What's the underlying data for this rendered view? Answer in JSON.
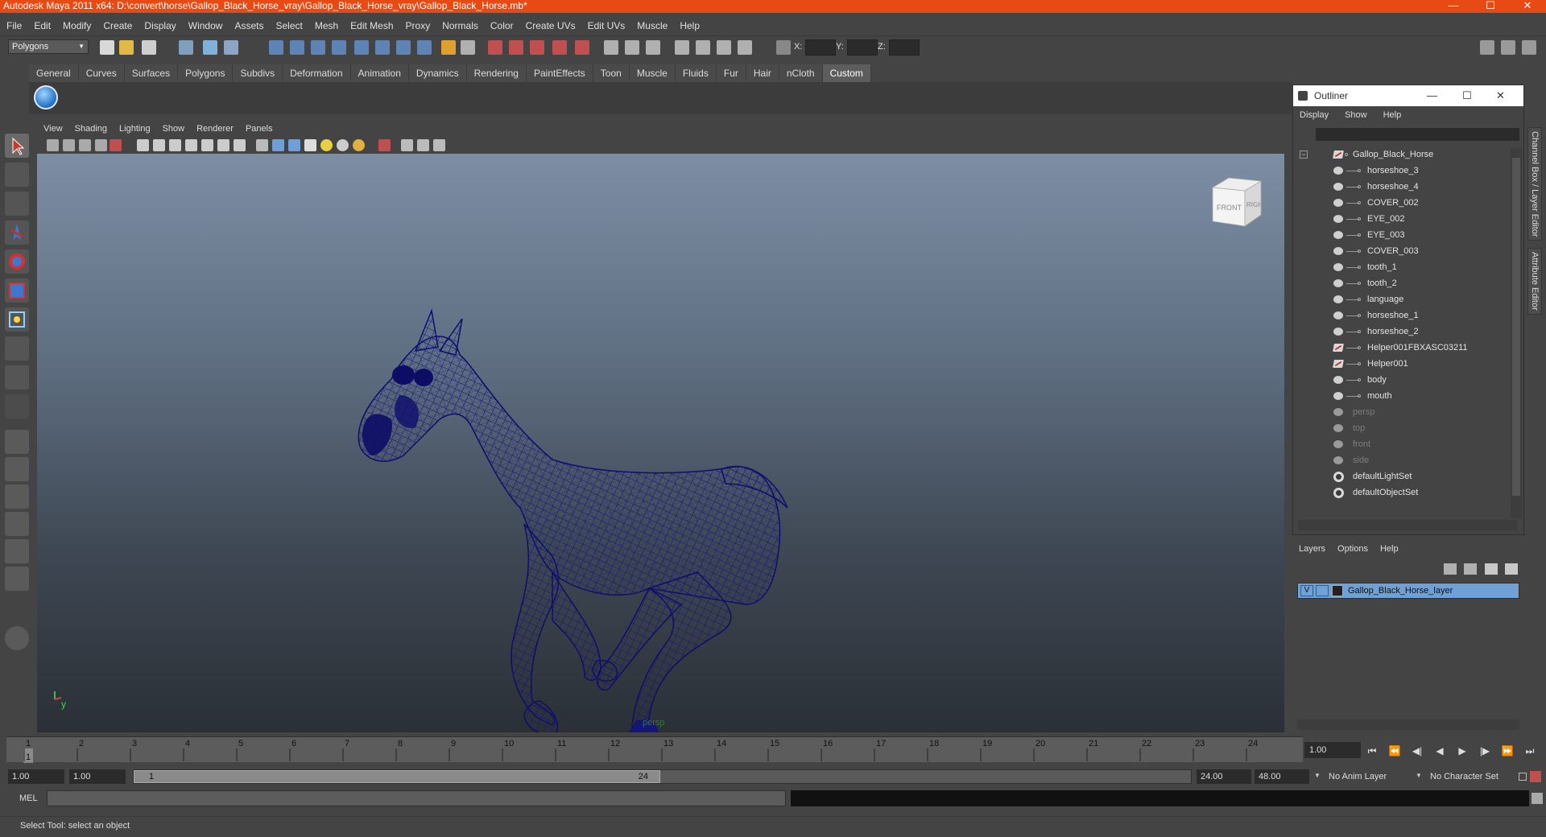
{
  "window": {
    "title": "Autodesk Maya 2011 x64: D:\\convert\\horse\\Gallop_Black_Horse_vray\\Gallop_Black_Horse_vray\\Gallop_Black_Horse.mb*",
    "controls": [
      "—",
      "☐",
      "✕"
    ]
  },
  "menubar": [
    "File",
    "Edit",
    "Modify",
    "Create",
    "Display",
    "Window",
    "Assets",
    "Select",
    "Mesh",
    "Edit Mesh",
    "Proxy",
    "Normals",
    "Color",
    "Create UVs",
    "Edit UVs",
    "Muscle",
    "Help"
  ],
  "statusline": {
    "mode": "Polygons",
    "x_label": "X:",
    "y_label": "Y:",
    "z_label": "Z:"
  },
  "shelf": {
    "tabs": [
      "General",
      "Curves",
      "Surfaces",
      "Polygons",
      "Subdivs",
      "Deformation",
      "Animation",
      "Dynamics",
      "Rendering",
      "PaintEffects",
      "Toon",
      "Muscle",
      "Fluids",
      "Fur",
      "Hair",
      "nCloth",
      "Custom"
    ],
    "active_tab": "Custom"
  },
  "viewport": {
    "menu": [
      "View",
      "Shading",
      "Lighting",
      "Show",
      "Renderer",
      "Panels"
    ],
    "camera_label": "persp",
    "viewcube": {
      "front": "FRONT",
      "right": "RIGHT"
    },
    "axis": {
      "y": "y"
    },
    "wire_color": "#12127a"
  },
  "outliner": {
    "title": "Outliner",
    "menu": [
      "Display",
      "Show",
      "Help"
    ],
    "items": [
      {
        "name": "Gallop_Black_Horse",
        "kind": "root"
      },
      {
        "name": "horseshoe_3",
        "kind": "mesh"
      },
      {
        "name": "horseshoe_4",
        "kind": "mesh"
      },
      {
        "name": "COVER_002",
        "kind": "mesh"
      },
      {
        "name": "EYE_002",
        "kind": "mesh"
      },
      {
        "name": "EYE_003",
        "kind": "mesh"
      },
      {
        "name": "COVER_003",
        "kind": "mesh"
      },
      {
        "name": "tooth_1",
        "kind": "mesh"
      },
      {
        "name": "tooth_2",
        "kind": "mesh"
      },
      {
        "name": "language",
        "kind": "mesh"
      },
      {
        "name": "horseshoe_1",
        "kind": "mesh"
      },
      {
        "name": "horseshoe_2",
        "kind": "mesh"
      },
      {
        "name": "Helper001FBXASC03211",
        "kind": "helper"
      },
      {
        "name": "Helper001",
        "kind": "helper"
      },
      {
        "name": "body",
        "kind": "mesh"
      },
      {
        "name": "mouth",
        "kind": "mesh"
      },
      {
        "name": "persp",
        "kind": "camera"
      },
      {
        "name": "top",
        "kind": "camera"
      },
      {
        "name": "front",
        "kind": "camera"
      },
      {
        "name": "side",
        "kind": "camera"
      },
      {
        "name": "defaultLightSet",
        "kind": "set"
      },
      {
        "name": "defaultObjectSet",
        "kind": "set"
      }
    ]
  },
  "layers": {
    "menu": [
      "Layers",
      "Options",
      "Help"
    ],
    "rows": [
      {
        "visible": "V",
        "name": "Gallop_Black_Horse_layer"
      }
    ]
  },
  "side_tabs": [
    "Channel Box / Layer Editor",
    "Attribute Editor"
  ],
  "timeline": {
    "ticks": [
      "1",
      "2",
      "3",
      "4",
      "5",
      "6",
      "7",
      "8",
      "9",
      "10",
      "11",
      "12",
      "13",
      "14",
      "15",
      "16",
      "17",
      "18",
      "19",
      "20",
      "21",
      "22",
      "23",
      "24"
    ],
    "current_frame": "1",
    "frame_field": "1.00"
  },
  "range": {
    "start": "1.00",
    "inner_start": "1.00",
    "slider_start": "1",
    "slider_end": "24",
    "end": "24.00",
    "outer_end": "48.00",
    "anim_layer": "No Anim Layer",
    "character_set": "No Character Set"
  },
  "command": {
    "label": "MEL"
  },
  "helpline": "Select Tool: select an object"
}
